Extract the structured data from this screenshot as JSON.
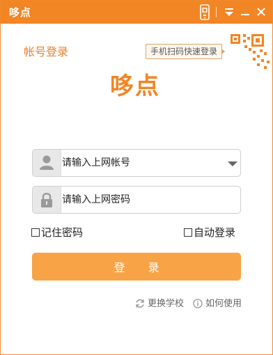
{
  "app": {
    "title": "哆点"
  },
  "header": {
    "login_label": "帐号登录",
    "qr_tip": "手机扫码快速登录",
    "logo_text": "哆点"
  },
  "form": {
    "account_placeholder": "请输入上网帐号",
    "password_placeholder": "请输入上网密码",
    "remember_label": "记住密码",
    "auto_login_label": "自动登录",
    "login_button": "登 录"
  },
  "footer": {
    "change_school": "更换学校",
    "how_to_use": "如何使用"
  },
  "colors": {
    "brand": "#f28524",
    "button": "#f9a347",
    "field_icon_bg": "#e8e8e8"
  },
  "icons": {
    "titlebar": [
      "phone-icon",
      "dropdown-menu-icon",
      "minimize-icon",
      "close-icon"
    ],
    "fields": [
      "user-icon",
      "lock-icon",
      "chevron-down-icon"
    ],
    "footer": [
      "refresh-icon",
      "info-icon"
    ],
    "corner": "qr-code-icon"
  }
}
